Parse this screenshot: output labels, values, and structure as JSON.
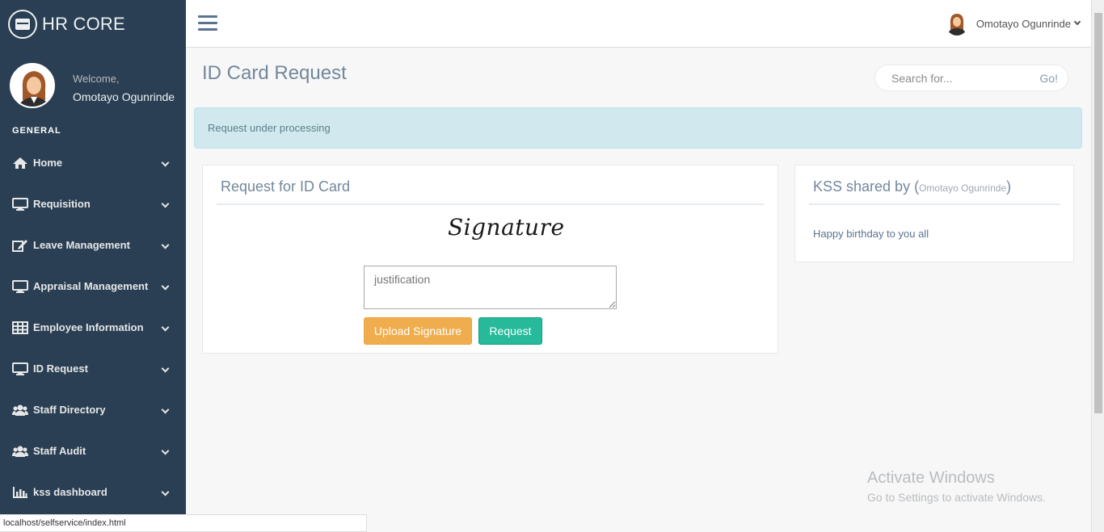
{
  "brand": {
    "title": "HR CORE"
  },
  "sidebar": {
    "welcome": "Welcome,",
    "user_name": "Omotayo Ogunrinde",
    "section_title": "GENERAL",
    "items": [
      {
        "label": "Home",
        "icon": "home-icon"
      },
      {
        "label": "Requisition",
        "icon": "desktop-icon"
      },
      {
        "label": "Leave Management",
        "icon": "edit-icon"
      },
      {
        "label": "Appraisal Management",
        "icon": "desktop-icon"
      },
      {
        "label": "Employee Information",
        "icon": "table-icon"
      },
      {
        "label": "ID Request",
        "icon": "desktop-icon"
      },
      {
        "label": "Staff Directory",
        "icon": "users-icon"
      },
      {
        "label": "Staff Audit",
        "icon": "users-icon"
      },
      {
        "label": "kss dashboard",
        "icon": "bar-chart-icon"
      }
    ]
  },
  "topnav": {
    "user_name": "Omotayo Ogunrinde"
  },
  "page": {
    "title": "ID Card Request"
  },
  "search": {
    "placeholder": "Search for...",
    "go_label": "Go!"
  },
  "alert": {
    "text": "Request under processing"
  },
  "request_panel": {
    "title": "Request for ID Card",
    "signature_text": "Signature",
    "justification_placeholder": "justification",
    "upload_label": "Upload Signature",
    "request_label": "Request"
  },
  "kss_panel": {
    "title_prefix": "KSS shared by (",
    "shared_by": "Omotayo Ogunrinde",
    "title_suffix": ")",
    "message": "Happy birthday to you all"
  },
  "status_bar": {
    "url": "localhost/selfservice/index.html"
  },
  "watermark": {
    "title": "Activate Windows",
    "subtitle": "Go to Settings to activate Windows."
  },
  "colors": {
    "sidebar_bg": "#2a3f54",
    "accent_green": "#26b99a",
    "accent_orange": "#f0ad4e",
    "alert_bg": "#d1e9ee"
  }
}
